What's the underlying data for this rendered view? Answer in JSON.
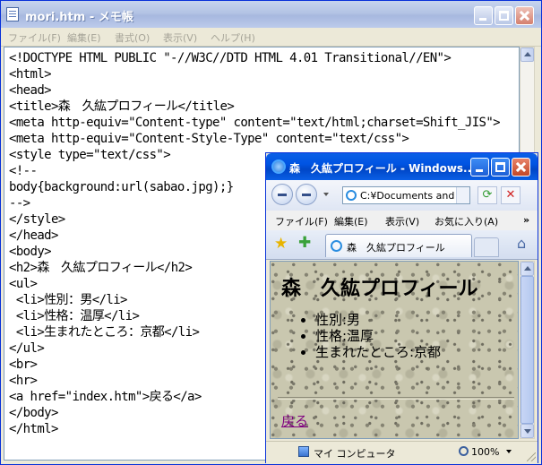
{
  "notepad": {
    "title": "mori.htm - メモ帳",
    "menu": [
      "ファイル(F)",
      "編集(E)",
      "書式(O)",
      "表示(V)",
      "ヘルプ(H)"
    ],
    "code_lines": [
      "<!DOCTYPE HTML PUBLIC \"-//W3C//DTD HTML 4.01 Transitional//EN\">",
      "<html>",
      "<head>",
      "<title>森　久紘プロフィール</title>",
      "<meta http-equiv=\"Content-type\" content=\"text/html;charset=Shift_JIS\">",
      "<meta http-equiv=\"Content-Style-Type\" content=\"text/css\">",
      "<style type=\"text/css\">",
      "<!--",
      "body{background:url(sabao.jpg);}",
      "-->",
      "</style>",
      "</head>",
      "<body>",
      "<h2>森　久紘プロフィール</h2>",
      "<ul>",
      " <li>性別：男</li>",
      " <li>性格：温厚</li>",
      " <li>生まれたところ：京都</li>",
      "</ul>",
      "<br>",
      "<hr>",
      "<a href=\"index.htm\">戻る</a>",
      "</body>",
      "</html>"
    ]
  },
  "browser": {
    "title": "森　久紘プロフィール - Windows...",
    "address": "C:¥Documents and S",
    "menu": [
      "ファイル(F)",
      "編集(E)",
      "表示(V)",
      "お気に入り(A)"
    ],
    "tab_label": "森　久紘プロフィール",
    "page": {
      "heading": "森　久紘プロフィール",
      "items": [
        "性別:男",
        "性格:温厚",
        "生まれたところ:京都"
      ],
      "link": "戻る"
    },
    "status": {
      "zone": "マイ コンピュータ",
      "zoom": "100%"
    }
  }
}
